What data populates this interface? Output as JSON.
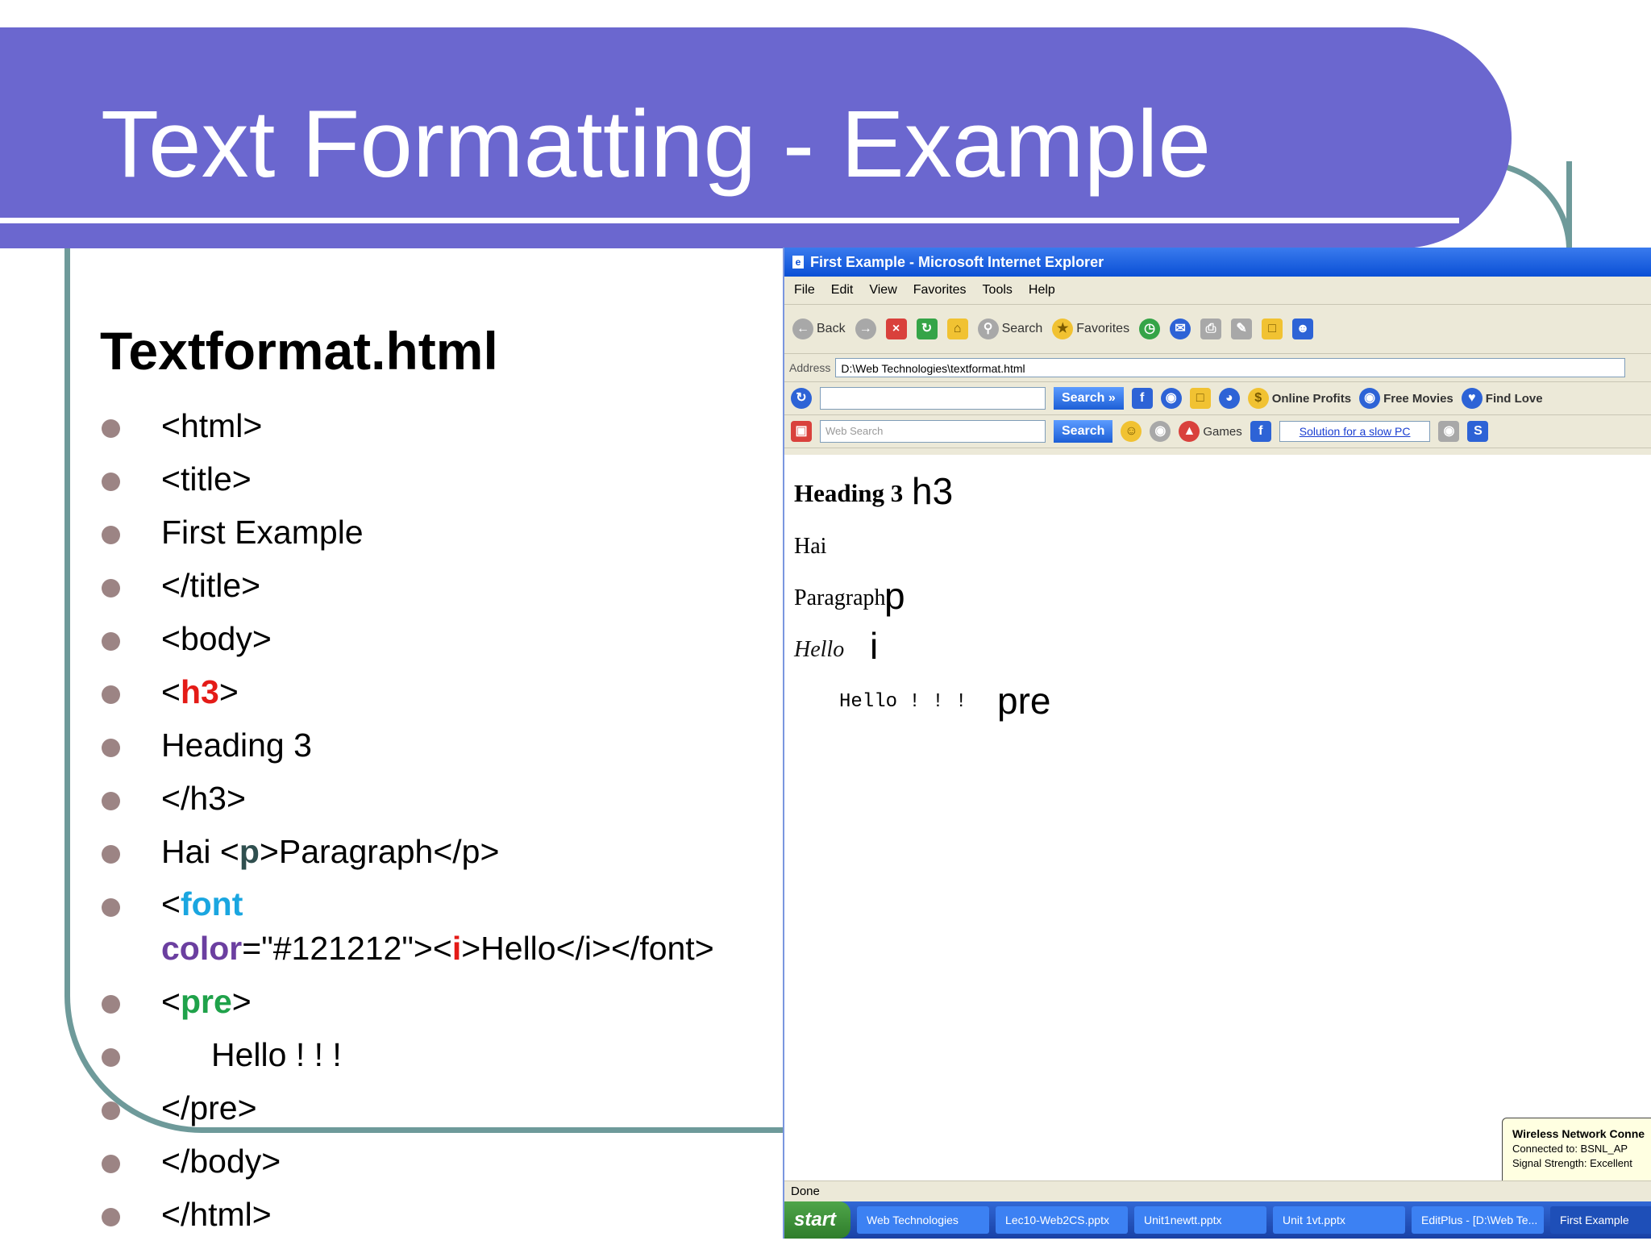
{
  "slide": {
    "title": "Text Formatting - Example",
    "file_heading": "Textformat.html"
  },
  "code_lines": {
    "l1": "<html>",
    "l2": "<title>",
    "l3": "First Example",
    "l4": "</title>",
    "l5": "<body>",
    "l6_open": "<",
    "l6_tag": "h3",
    "l6_close": ">",
    "l7": "Heading 3",
    "l8": "</h3>",
    "l9_pre": "Hai <",
    "l9_tag": "p",
    "l9_post": ">Paragraph</p>",
    "l10_open": "<",
    "l10_tag": "font",
    "l10_attr": "color",
    "l10_mid": "=\"#121212\"><",
    "l10_itag": "i",
    "l10_post": ">Hello</i></font>",
    "l11_open": "<",
    "l11_tag": "pre",
    "l11_close": ">",
    "l12": "Hello ! ! !",
    "l13": "</pre>",
    "l14": "</body>",
    "l15": "</html>"
  },
  "colors": {
    "title_band": "#6b67cf",
    "frame": "#6e9a9a",
    "kw_h3": "#e41b17",
    "kw_p": "#2f4f4f",
    "kw_font": "#1aa6e0",
    "kw_color": "#6b3fa0",
    "kw_pre": "#1fa24a"
  },
  "browser": {
    "window_title": "First Example - Microsoft Internet Explorer",
    "menu": [
      "File",
      "Edit",
      "View",
      "Favorites",
      "Tools",
      "Help"
    ],
    "toolbar": {
      "back": "Back",
      "search": "Search",
      "favorites": "Favorites"
    },
    "address_label": "Address",
    "address_value": "D:\\Web Technologies\\textformat.html",
    "bar1": {
      "search_btn": "Search »",
      "online_profits": "Online Profits",
      "free_movies": "Free Movies",
      "find_love": "Find Love"
    },
    "bar2": {
      "search_placeholder": "Web Search",
      "search_btn": "Search",
      "games": "Games",
      "slow_pc_link": "Solution for a slow PC"
    },
    "content": {
      "heading3": "Heading 3",
      "hai": "Hai",
      "paragraph": "Paragraph",
      "hello_italic": "Hello",
      "pre_text": "Hello ! ! !"
    },
    "annotations": {
      "h3": "h3",
      "p": "p",
      "i": "i",
      "pre": "pre"
    },
    "popup": {
      "title": "Wireless Network Conne",
      "line1": "Connected to: BSNL_AP",
      "line2": "Signal Strength: Excellent"
    },
    "status": "Done",
    "taskbar": {
      "start": "start",
      "items": [
        "Web Technologies",
        "Lec10-Web2CS.pptx",
        "Unit1newtt.pptx",
        "Unit 1vt.pptx",
        "EditPlus - [D:\\Web Te...",
        "First Example"
      ]
    }
  }
}
